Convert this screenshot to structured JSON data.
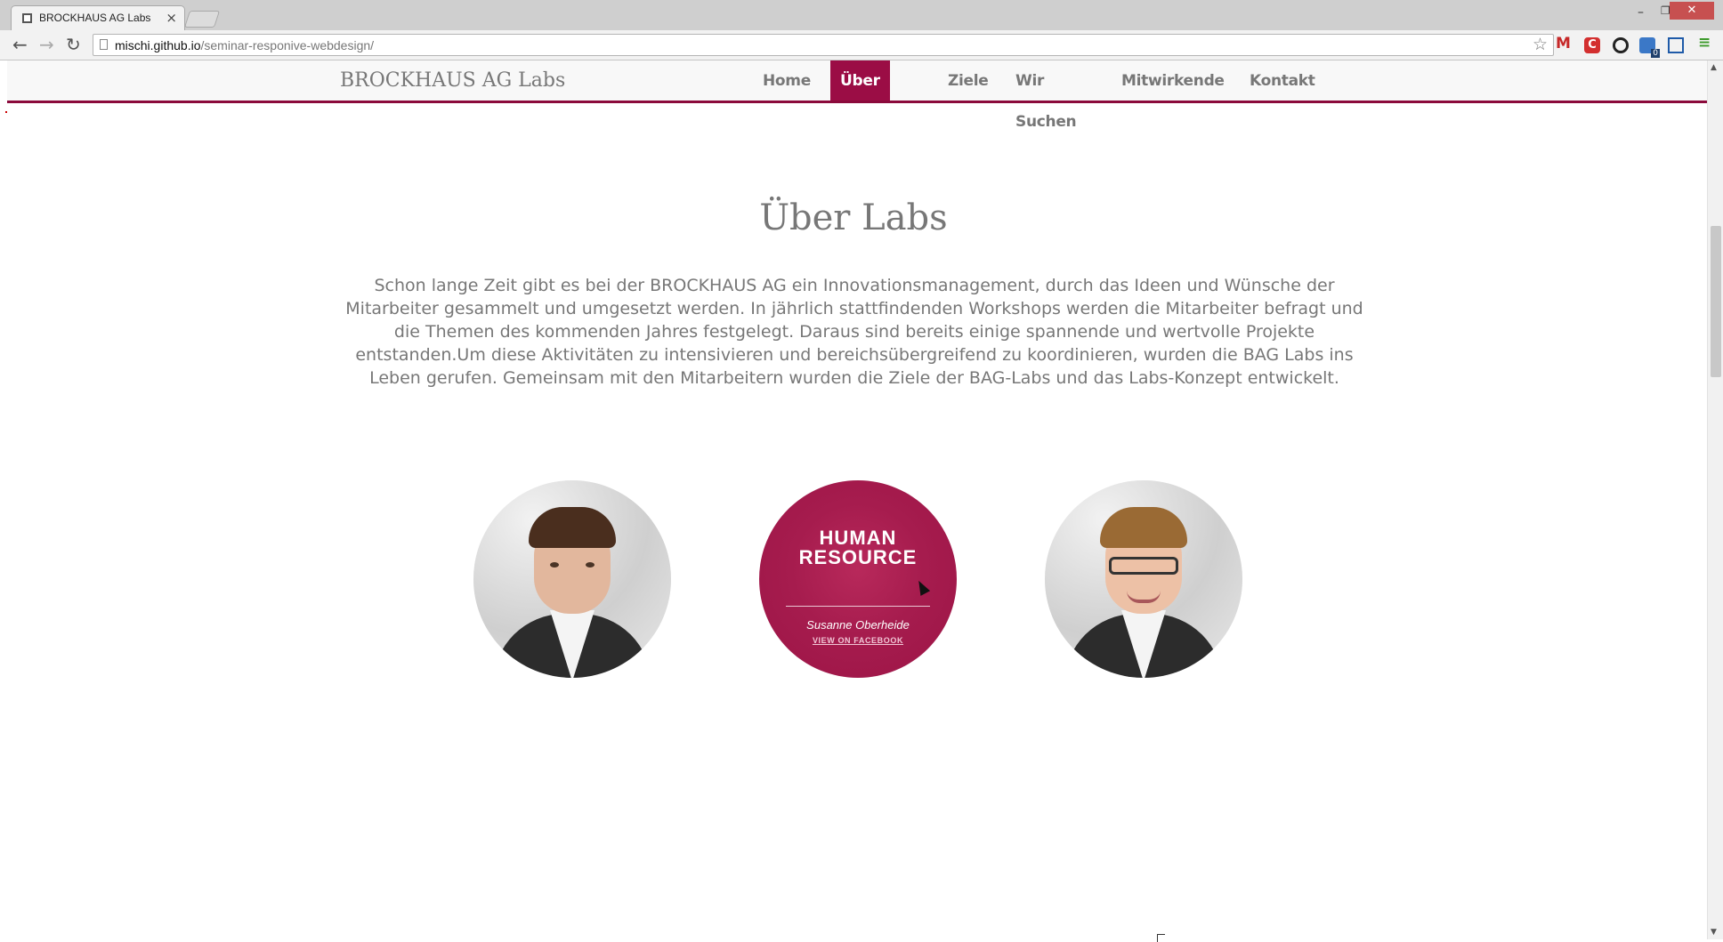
{
  "browser": {
    "tab_title": "BROCKHAUS AG Labs",
    "tab_close": "×",
    "window_minimize": "–",
    "window_restore": "❐",
    "window_close": "✕",
    "back_icon": "←",
    "forward_icon": "→",
    "reload_icon": "↻",
    "url_host": "mischi.github.io",
    "url_path": "/seminar-responive-webdesign/",
    "star_icon": "☆",
    "ext_gmail": "M",
    "ext_c": "C",
    "menu_icon": "≡"
  },
  "site": {
    "brand": "BROCKHAUS AG Labs",
    "nav": [
      {
        "label": "Home",
        "active": false
      },
      {
        "label": "Über Labs",
        "active": true
      },
      {
        "label": "Ziele",
        "active": false
      },
      {
        "label": "Wir Suchen",
        "active": false
      },
      {
        "label": "Mitwirkende",
        "active": false
      },
      {
        "label": "Kontakt",
        "active": false
      }
    ],
    "accent_color": "#9b0d45"
  },
  "section": {
    "title": "Über Labs",
    "intro": "Schon lange Zeit gibt es bei der BROCKHAUS AG ein Innovationsmanagement, durch das Ideen und Wünsche der Mitarbeiter gesammelt und umgesetzt werden. In jährlich stattfindenden Workshops werden die Mitarbeiter befragt und die Themen des kommenden Jahres festgelegt. Daraus sind bereits einige spannende und wertvolle Projekte entstanden.Um diese Aktivitäten zu intensivieren und bereichsübergreifend zu koordinieren, wurden die BAG Labs ins Leben gerufen. Gemeinsam mit den Mitarbeitern wurden die Ziele der BAG-Labs und das Labs-Konzept entwickelt."
  },
  "team": {
    "hr_card": {
      "title_line1": "HUMAN",
      "title_line2": "RESOURCE",
      "name": "Susanne Oberheide",
      "link": "VIEW ON FACEBOOK"
    }
  }
}
